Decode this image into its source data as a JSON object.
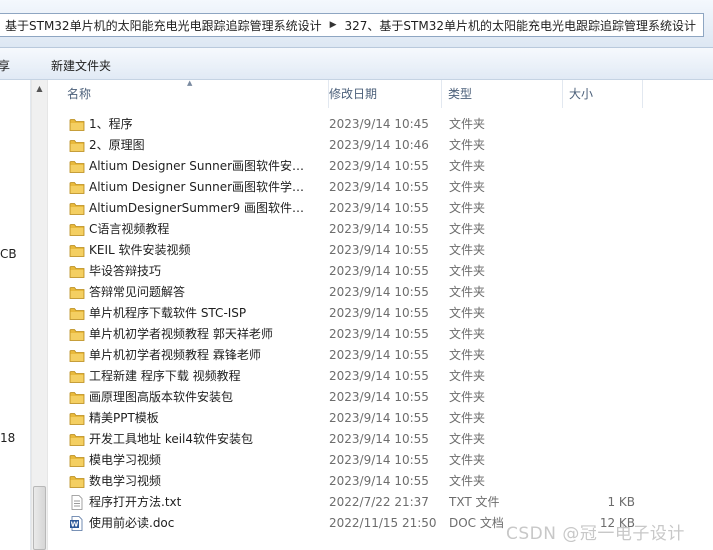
{
  "address_bar": {
    "crumbs": [
      "基于STM32单片机的太阳能充电光电跟踪追踪管理系统设计",
      "327、基于STM32单片机的太阳能充电光电跟踪追踪管理系统设计"
    ]
  },
  "toolbar": {
    "share_label": "享",
    "new_folder_label": "新建文件夹"
  },
  "nav_pane": {
    "partial_labels": [
      "CB",
      "18"
    ]
  },
  "columns": {
    "name": "名称",
    "date": "修改日期",
    "type": "类型",
    "size": "大小"
  },
  "files": [
    {
      "name": "1、程序",
      "date": "2023/9/14 10:45",
      "type": "文件夹",
      "size": "",
      "icon": "folder-icon"
    },
    {
      "name": "2、原理图",
      "date": "2023/9/14 10:46",
      "type": "文件夹",
      "size": "",
      "icon": "folder-icon"
    },
    {
      "name": "Altium Designer Sunner画图软件安装...",
      "date": "2023/9/14 10:55",
      "type": "文件夹",
      "size": "",
      "icon": "folder-icon"
    },
    {
      "name": "Altium Designer Sunner画图软件学习...",
      "date": "2023/9/14 10:55",
      "type": "文件夹",
      "size": "",
      "icon": "folder-icon"
    },
    {
      "name": "AltiumDesignerSummer9 画图软件安...",
      "date": "2023/9/14 10:55",
      "type": "文件夹",
      "size": "",
      "icon": "folder-icon"
    },
    {
      "name": "C语言视频教程",
      "date": "2023/9/14 10:55",
      "type": "文件夹",
      "size": "",
      "icon": "folder-icon"
    },
    {
      "name": "KEIL 软件安装视频",
      "date": "2023/9/14 10:55",
      "type": "文件夹",
      "size": "",
      "icon": "folder-icon"
    },
    {
      "name": "毕设答辩技巧",
      "date": "2023/9/14 10:55",
      "type": "文件夹",
      "size": "",
      "icon": "folder-icon"
    },
    {
      "name": "答辩常见问题解答",
      "date": "2023/9/14 10:55",
      "type": "文件夹",
      "size": "",
      "icon": "folder-icon"
    },
    {
      "name": "单片机程序下载软件 STC-ISP",
      "date": "2023/9/14 10:55",
      "type": "文件夹",
      "size": "",
      "icon": "folder-icon"
    },
    {
      "name": "单片机初学者视频教程 郭天祥老师",
      "date": "2023/9/14 10:55",
      "type": "文件夹",
      "size": "",
      "icon": "folder-icon"
    },
    {
      "name": "单片机初学者视频教程 霖锋老师",
      "date": "2023/9/14 10:55",
      "type": "文件夹",
      "size": "",
      "icon": "folder-icon"
    },
    {
      "name": "工程新建  程序下载 视频教程",
      "date": "2023/9/14 10:55",
      "type": "文件夹",
      "size": "",
      "icon": "folder-icon"
    },
    {
      "name": "画原理图高版本软件安装包",
      "date": "2023/9/14 10:55",
      "type": "文件夹",
      "size": "",
      "icon": "folder-icon"
    },
    {
      "name": "精美PPT模板",
      "date": "2023/9/14 10:55",
      "type": "文件夹",
      "size": "",
      "icon": "folder-icon"
    },
    {
      "name": "开发工具地址 keil4软件安装包",
      "date": "2023/9/14 10:55",
      "type": "文件夹",
      "size": "",
      "icon": "folder-icon"
    },
    {
      "name": "模电学习视频",
      "date": "2023/9/14 10:55",
      "type": "文件夹",
      "size": "",
      "icon": "folder-icon"
    },
    {
      "name": "数电学习视频",
      "date": "2023/9/14 10:55",
      "type": "文件夹",
      "size": "",
      "icon": "folder-icon"
    },
    {
      "name": "程序打开方法.txt",
      "date": "2022/7/22 21:37",
      "type": "TXT 文件",
      "size": "1 KB",
      "icon": "text-file-icon"
    },
    {
      "name": "使用前必读.doc",
      "date": "2022/11/15 21:50",
      "type": "DOC 文档",
      "size": "12 KB",
      "icon": "word-doc-icon"
    }
  ],
  "watermark": "CSDN @冠一电子设计",
  "colors": {
    "folder": "#e8b93c",
    "selection_border": "#8ea6c2",
    "header_text": "#4c607a"
  }
}
